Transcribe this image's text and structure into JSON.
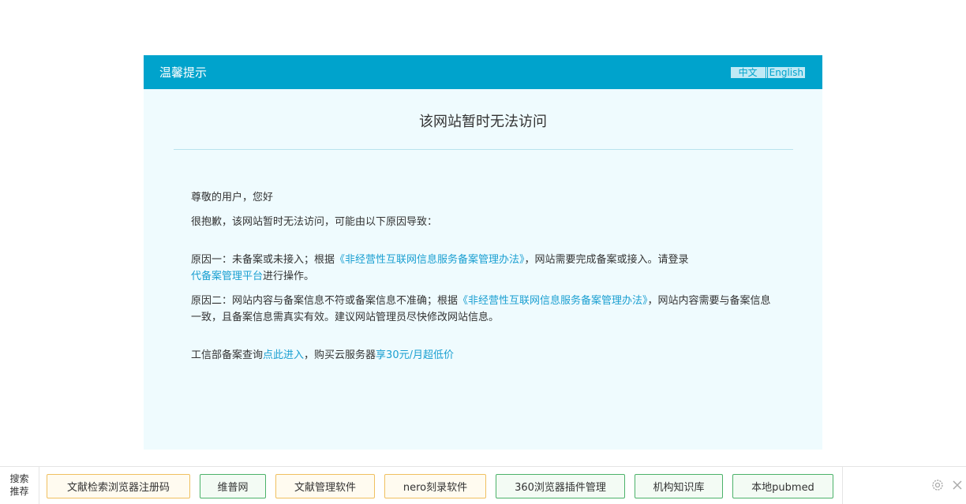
{
  "notice": {
    "title": "温馨提示",
    "lang_zh": "中文",
    "lang_en": "English",
    "heading": "该网站暂时无法访问",
    "greeting": "尊敬的用户，您好",
    "apology": "很抱歉，该网站暂时无法访问，可能由以下原因导致：",
    "reason1_prefix": "原因一：未备案或未接入；根据",
    "reason1_link": "《非经营性互联网信息服务备案管理办法》",
    "reason1_suffix": "，网站需要完成备案或接入。请登录",
    "reason1_platform_link": "代备案管理平台",
    "reason1_end": "进行操作。",
    "reason2_prefix": "原因二：网站内容与备案信息不符或备案信息不准确；根据",
    "reason2_link": "《非经营性互联网信息服务备案管理办法》",
    "reason2_suffix": "，网站内容需要与备案信息一致，且备案信息需真实有效。建议网站管理员尽快修改网站信息。",
    "footer_prefix": "工信部备案查询",
    "footer_link1": "点此进入",
    "footer_mid": "，购买云服务器",
    "footer_link2": "享30元/月超低价"
  },
  "bottom_bar": {
    "label_line1": "搜索",
    "label_line2": "推荐",
    "chips": [
      {
        "label": "文献检索浏览器注册码",
        "style": "orange"
      },
      {
        "label": "维普网",
        "style": "green"
      },
      {
        "label": "文献管理软件",
        "style": "orange"
      },
      {
        "label": "nero刻录软件",
        "style": "orange"
      },
      {
        "label": "360浏览器插件管理",
        "style": "green"
      },
      {
        "label": "机构知识库",
        "style": "green"
      },
      {
        "label": "本地pubmed",
        "style": "green"
      }
    ],
    "icons": [
      "gear-icon",
      "close-icon"
    ]
  }
}
